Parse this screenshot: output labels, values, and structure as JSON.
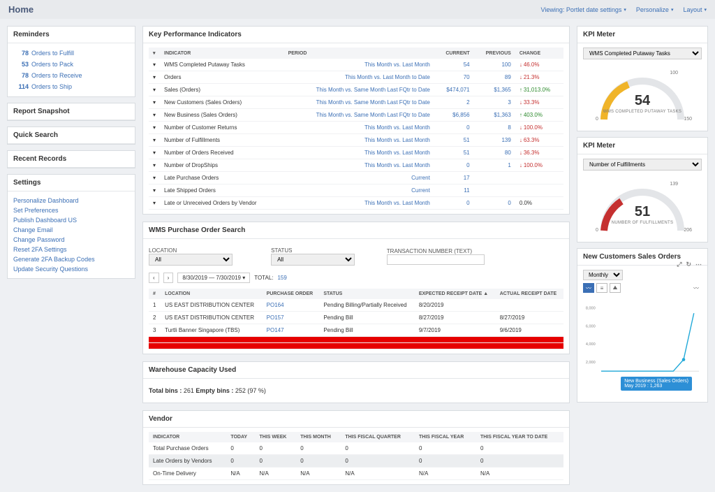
{
  "page_title": "Home",
  "topbar": {
    "viewing": "Viewing: Portlet date settings",
    "personalize": "Personalize",
    "layout": "Layout"
  },
  "reminders": {
    "title": "Reminders",
    "items": [
      {
        "count": "78",
        "label": "Orders to Fulfill"
      },
      {
        "count": "53",
        "label": "Orders to Pack"
      },
      {
        "count": "78",
        "label": "Orders to Receive"
      },
      {
        "count": "114",
        "label": "Orders to Ship"
      }
    ]
  },
  "report_snapshot_title": "Report Snapshot",
  "quick_search_title": "Quick Search",
  "recent_records_title": "Recent Records",
  "settings": {
    "title": "Settings",
    "links": [
      "Personalize Dashboard",
      "Set Preferences",
      "Publish Dashboard   US",
      "Change Email",
      "Change Password",
      "Reset 2FA Settings",
      "Generate 2FA Backup Codes",
      "Update Security Questions"
    ]
  },
  "kpi": {
    "title": "Key Performance Indicators",
    "headers": {
      "indicator": "Indicator",
      "period": "Period",
      "current": "Current",
      "previous": "Previous",
      "change": "Change"
    },
    "rows": [
      {
        "indicator": "WMS Completed Putaway Tasks",
        "period": "This Month vs. Last Month",
        "current": "54",
        "previous": "100",
        "change": "46.0%",
        "dir": "down"
      },
      {
        "indicator": "Orders",
        "period": "This Month vs. Last Month to Date",
        "current": "70",
        "previous": "89",
        "change": "21.3%",
        "dir": "down"
      },
      {
        "indicator": "Sales (Orders)",
        "period": "This Month vs. Same Month Last FQtr to Date",
        "current": "$474,071",
        "previous": "$1,365",
        "change": "31,013.0%",
        "dir": "up"
      },
      {
        "indicator": "New Customers (Sales Orders)",
        "period": "This Month vs. Same Month Last FQtr to Date",
        "current": "2",
        "previous": "3",
        "change": "33.3%",
        "dir": "down"
      },
      {
        "indicator": "New Business (Sales Orders)",
        "period": "This Month vs. Same Month Last FQtr to Date",
        "current": "$6,856",
        "previous": "$1,363",
        "change": "403.0%",
        "dir": "up"
      },
      {
        "indicator": "Number of Customer Returns",
        "period": "This Month vs. Last Month",
        "current": "0",
        "previous": "8",
        "change": "100.0%",
        "dir": "down"
      },
      {
        "indicator": "Number of Fulfillments",
        "period": "This Month vs. Last Month",
        "current": "51",
        "previous": "139",
        "change": "63.3%",
        "dir": "down"
      },
      {
        "indicator": "Number of Orders Received",
        "period": "This Month vs. Last Month",
        "current": "51",
        "previous": "80",
        "change": "36.3%",
        "dir": "down"
      },
      {
        "indicator": "Number of DropShips",
        "period": "This Month vs. Last Month",
        "current": "0",
        "previous": "1",
        "change": "100.0%",
        "dir": "down"
      },
      {
        "indicator": "Late Purchase Orders",
        "period": "Current",
        "current": "17",
        "previous": "",
        "change": "",
        "dir": ""
      },
      {
        "indicator": "Late Shipped Orders",
        "period": "Current",
        "current": "11",
        "previous": "",
        "change": "",
        "dir": ""
      },
      {
        "indicator": "Late or Unreceived Orders by Vendor",
        "period": "This Month vs. Last Month",
        "current": "0",
        "previous": "0",
        "change": "0.0%",
        "dir": ""
      }
    ]
  },
  "po_search": {
    "title": "WMS Purchase Order Search",
    "location_label": "Location",
    "status_label": "Status",
    "txn_label": "Transaction Number (Text)",
    "location_val": "All",
    "status_val": "All",
    "date_range": "8/30/2019 — 7/30/2019",
    "total_label": "TOTAL:",
    "total_val": "159",
    "headers": {
      "num": "#",
      "location": "Location",
      "po": "Purchase Order",
      "status": "Status",
      "expected": "Expected Receipt Date ▲",
      "actual": "Actual Receipt Date"
    },
    "rows": [
      {
        "n": "1",
        "loc": "US EAST DISTRIBUTION CENTER",
        "po": "PO164",
        "status": "Pending Billing/Partially Received",
        "expected": "8/20/2019",
        "actual": ""
      },
      {
        "n": "2",
        "loc": "US EAST DISTRIBUTION CENTER",
        "po": "PO157",
        "status": "Pending Bill",
        "expected": "8/27/2019",
        "actual": "8/27/2019"
      },
      {
        "n": "3",
        "loc": "Turtli Banner Singapore (TBS)",
        "po": "PO147",
        "status": "Pending Bill",
        "expected": "9/7/2019",
        "actual": "9/6/2019"
      },
      {
        "n": "",
        "loc": "",
        "po": "",
        "status": "",
        "expected": "",
        "actual": ""
      },
      {
        "n": "",
        "loc": "",
        "po": "",
        "status": "",
        "expected": "",
        "actual": ""
      }
    ]
  },
  "capacity": {
    "title": "Warehouse Capacity Used",
    "text_prefix": "Total bins : ",
    "total": "261",
    "empty_prefix": " Empty bins : ",
    "empty": "252 (97 %)"
  },
  "vendor": {
    "title": "Vendor",
    "headers": {
      "indicator": "Indicator",
      "today": "Today",
      "this_week": "This Week",
      "this_month": "This Month",
      "this_fq": "This Fiscal Quarter",
      "this_fy": "This Fiscal Year",
      "this_fytd": "This Fiscal Year to Date"
    },
    "rows": [
      {
        "ind": "Total Purchase Orders",
        "v": [
          "0",
          "0",
          "0",
          "0",
          "0",
          "0"
        ]
      },
      {
        "ind": "Late Orders by Vendors",
        "v": [
          "0",
          "0",
          "0",
          "0",
          "0",
          "0"
        ]
      },
      {
        "ind": "On-Time Delivery",
        "v": [
          "N/A",
          "N/A",
          "N/A",
          "N/A",
          "N/A",
          "N/A"
        ]
      }
    ]
  },
  "meter1": {
    "title": "KPI Meter",
    "select": "WMS Completed Putaway Tasks",
    "value": "54",
    "label": "WMS COMPLETED PUTAWAY TASKS",
    "min": "0",
    "max": "150",
    "tick": "100"
  },
  "meter2": {
    "title": "KPI Meter",
    "select": "Number of Fulfillments",
    "value": "51",
    "label": "NUMBER OF FULFILLMENTS",
    "min": "0",
    "max": "206",
    "tick": "139"
  },
  "sales_chart": {
    "title": "New Customers Sales Orders",
    "period": "Monthly",
    "tooltip_line1": "New Business (Sales Orders)",
    "tooltip_line2": "May 2019 : 1,263",
    "y_ticks": [
      "8,000",
      "6,000",
      "4,000",
      "2,000"
    ]
  },
  "chart_data": {
    "type": "line",
    "title": "New Customers Sales Orders",
    "xlabel": "",
    "ylabel": "",
    "ylim": [
      0,
      8000
    ],
    "series": [
      {
        "name": "New Business (Sales Orders)",
        "values": [
          0,
          0,
          0,
          0,
          0,
          0,
          0,
          0,
          1263,
          6800
        ],
        "color": "#1fa8d8"
      }
    ],
    "highlight": {
      "label": "May 2019",
      "value": 1263
    }
  }
}
